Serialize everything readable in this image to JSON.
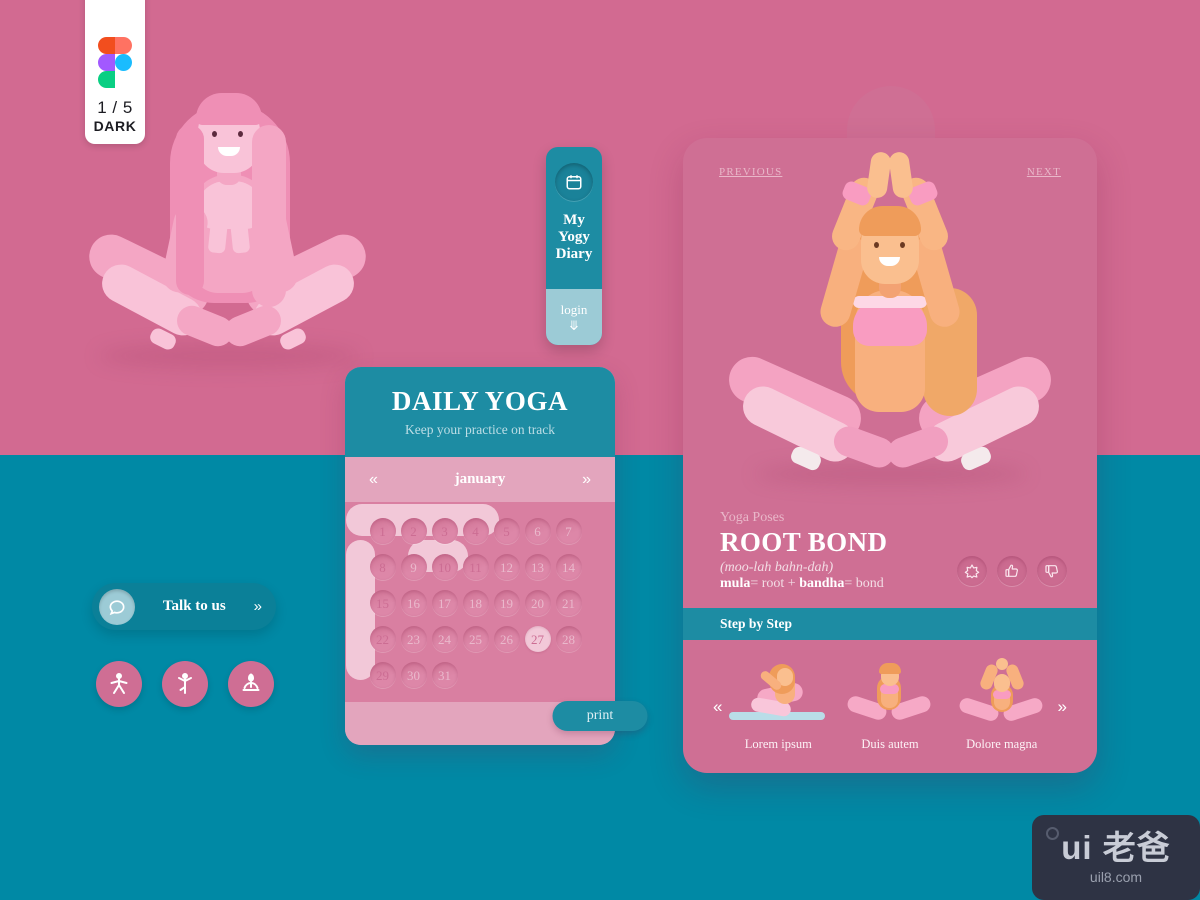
{
  "theme": {
    "bg_pink": "#d26a91",
    "bg_teal": "#0089a5",
    "card_pink": "#cf6f94",
    "accent_teal": "#1d8ca3",
    "light_pink": "#e3a5bd",
    "highlight_pink": "#f2c8d8"
  },
  "figma_badge": {
    "count": "1 / 5",
    "mode": "DARK",
    "logo_icon": "figma-logo-icon"
  },
  "diary_tab": {
    "icon": "calendar-icon",
    "title": "My\nYogy\nDiary",
    "title_lines": [
      "My",
      "Yogy",
      "Diary"
    ],
    "login_label": "login",
    "login_chevron": "»"
  },
  "calendar": {
    "title": "DAILY YOGA",
    "subtitle": "Keep your practice on track",
    "prev_arrow": "«",
    "next_arrow": "»",
    "month": "january",
    "days": [
      "1",
      "2",
      "3",
      "4",
      "5",
      "6",
      "7",
      "8",
      "9",
      "10",
      "11",
      "12",
      "13",
      "14",
      "15",
      "16",
      "17",
      "18",
      "19",
      "20",
      "21",
      "22",
      "23",
      "24",
      "25",
      "26",
      "27",
      "28",
      "29",
      "30",
      "31"
    ],
    "marked_days": [
      "1",
      "2",
      "3",
      "4",
      "5",
      "8",
      "10",
      "11",
      "15",
      "22",
      "27",
      "29"
    ],
    "print_label": "print"
  },
  "talk_widget": {
    "icon": "chat-bubble-icon",
    "label": "Talk to us",
    "chevron": "»"
  },
  "pose_buttons": [
    {
      "name": "star-pose-icon"
    },
    {
      "name": "tree-pose-icon"
    },
    {
      "name": "lotus-pose-icon"
    }
  ],
  "pose_card": {
    "previous_label": "PREVIOUS",
    "next_label": "NEXT",
    "kicker": "Yoga Poses",
    "name": "ROOT BOND",
    "phonetic": "(moo-lah bahn-dah)",
    "etymology_parts": [
      {
        "text": "mula",
        "bold": true
      },
      {
        "text": "= root + ",
        "bold": false
      },
      {
        "text": "bandha",
        "bold": true
      },
      {
        "text": "= bond",
        "bold": false
      }
    ],
    "actions": [
      {
        "name": "star-icon"
      },
      {
        "name": "thumbs-up-icon"
      },
      {
        "name": "thumbs-down-icon"
      }
    ],
    "step_bar_label": "Step by Step",
    "steps_prev": "«",
    "steps_next": "»",
    "steps": [
      {
        "label": "Lorem ipsum"
      },
      {
        "label": "Duis autem"
      },
      {
        "label": "Dolore magna"
      }
    ]
  },
  "watermark": {
    "main": "ui 老爸",
    "sub": "uil8.com"
  }
}
